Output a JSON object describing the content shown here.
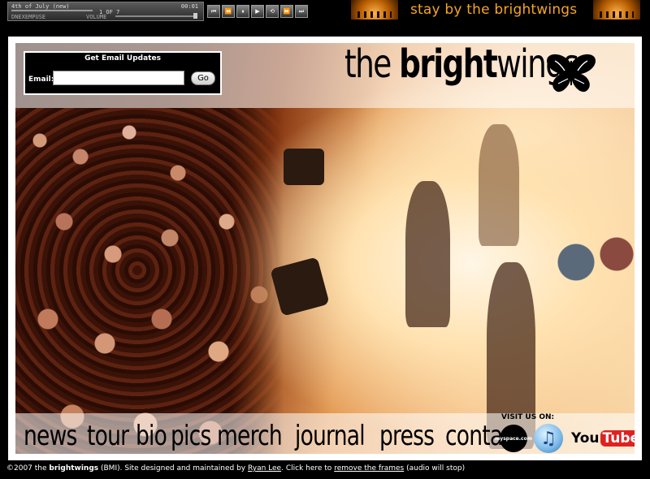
{
  "player": {
    "track_title": "4th of July (new)",
    "time": "00:01",
    "track_count": "1 OF 7",
    "left_label": "DNEXEMPUSE",
    "volume_label": "VOLUME",
    "controls": [
      "⏮",
      "⏪",
      "⏸",
      "▶",
      "⟲",
      "⏩",
      "⏭"
    ]
  },
  "header": {
    "tagline": "stay by the brightwings",
    "tagline_color": "#f5a623"
  },
  "logo": {
    "the": "the ",
    "bright": "bright",
    "wings": "wings",
    "icon": "butterfly-icon"
  },
  "email": {
    "title": "Get Email Updates",
    "label": "Email:",
    "value": "",
    "placeholder": "",
    "button": "Go"
  },
  "nav": {
    "items": [
      "news",
      "tour",
      "bio",
      "pics",
      "merch",
      "journal",
      "press",
      "contact"
    ]
  },
  "social": {
    "visit_label": "VISIT US ON:",
    "myspace_text": "myspace.com",
    "itunes_icon": "itunes-icon",
    "youtube_you": "You",
    "youtube_tube": "Tube"
  },
  "footer": {
    "copyright": "©2007 the ",
    "band": "brightwings",
    "rights": " (BMI). Site designed and maintained by ",
    "designer": "Ryan Lee",
    "click_here": ". Click here to ",
    "remove_frames": "remove the frames",
    "audio_note": " (audio will stop)"
  }
}
